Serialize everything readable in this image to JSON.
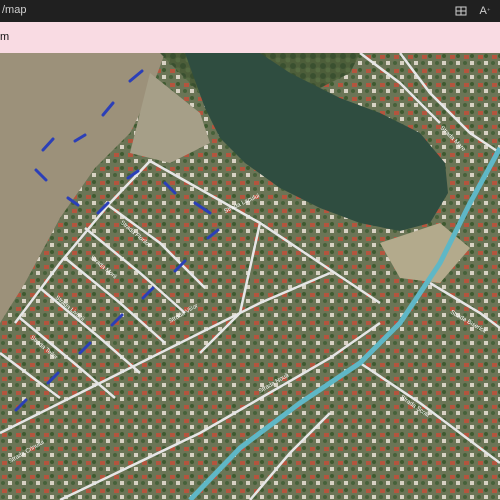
{
  "window": {
    "title": "/map",
    "layout_icon": "layout-icon",
    "font_icon": "text-size-icon",
    "font_label": "A"
  },
  "banner": {
    "text": "m"
  },
  "map": {
    "type": "satellite-map",
    "colors": {
      "field": "#9a8f78",
      "lake": "#2f4d40",
      "road": "#e8e8e8",
      "main_road": "#5fb7c6",
      "marker": "#2b3fb8"
    },
    "street_labels": [
      "Strada Lacului",
      "Strada Florilor",
      "Strada Morii",
      "Strada Livezii",
      "Strada Teilor",
      "Strada Viilor",
      "Strada Mare",
      "Strada Nouă",
      "Strada Școlii",
      "Strada Bisericii",
      "Strada Crinului"
    ]
  }
}
